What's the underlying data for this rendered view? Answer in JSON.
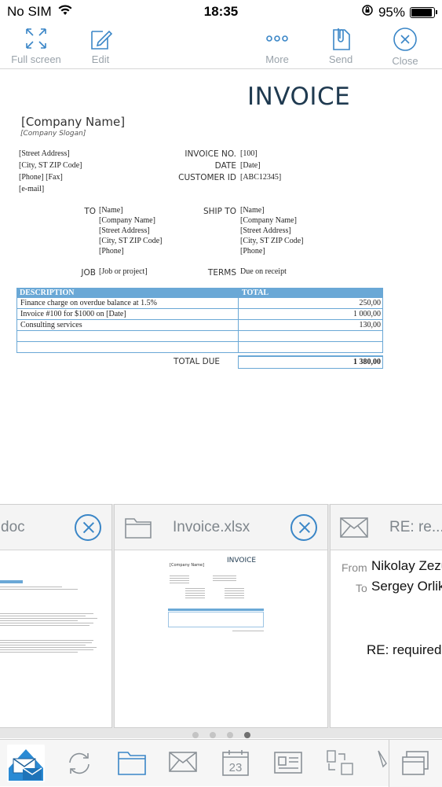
{
  "status": {
    "carrier": "No SIM",
    "time": "18:35",
    "battery": "95%",
    "battery_level": 0.95
  },
  "toolbar": {
    "full_screen": "Full screen",
    "edit": "Edit",
    "more": "More",
    "send": "Send",
    "close": "Close"
  },
  "invoice": {
    "title": "INVOICE",
    "company_name": "[Company Name]",
    "company_slogan": "[Company Slogan]",
    "address": [
      "[Street Address]",
      "[City, ST  ZIP Code]",
      "[Phone] [Fax]",
      "[e-mail]"
    ],
    "invoice_no_label": "INVOICE NO.",
    "invoice_no": "[100]",
    "date_label": "DATE",
    "date": "[Date]",
    "customer_id_label": "CUSTOMER ID",
    "customer_id": "[ABC12345]",
    "to_label": "TO",
    "to": [
      "[Name]",
      "[Company Name]",
      "[Street Address]",
      "[City, ST  ZIP Code]",
      "[Phone]"
    ],
    "ship_to_label": "SHIP TO",
    "ship_to": [
      "[Name]",
      "[Company Name]",
      "[Street Address]",
      "[City, ST  ZIP Code]",
      "[Phone]"
    ],
    "job_label": "JOB",
    "job": "[Job or project]",
    "terms_label": "TERMS",
    "terms": "Due on receipt",
    "col_description": "DESCRIPTION",
    "col_total": "TOTAL",
    "lines": [
      {
        "description": "Finance charge on overdue balance at 1.5%",
        "total": "250,00"
      },
      {
        "description": "Invoice #100 for $1000 on [Date]",
        "total": "1 000,00"
      },
      {
        "description": "Consulting services",
        "total": "130,00"
      },
      {
        "description": "",
        "total": ""
      },
      {
        "description": "",
        "total": ""
      }
    ],
    "total_due_label": "TOTAL DUE",
    "total_due": "1 380,00"
  },
  "tabs": [
    {
      "title": "doc"
    },
    {
      "title": "Invoice.xlsx",
      "preview_title": "INVOICE",
      "preview_company": "[Company Name]"
    },
    {
      "title": "RE: re...",
      "from_label": "From",
      "from": "Nikolay Zezu",
      "to_label": "To",
      "to": "Sergey Orlik",
      "subject": "RE: required"
    }
  ],
  "page_dots": {
    "count": 4,
    "active": 3
  }
}
